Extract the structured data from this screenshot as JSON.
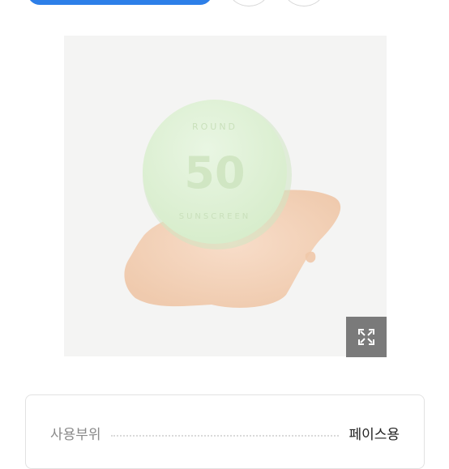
{
  "icons": {
    "expand": "expand-icon"
  },
  "colors": {
    "accent": "#2d7fe8",
    "image_background": "#f4f4f3",
    "cushion_green": "#dff0d7",
    "foundation": "#f1cfb4"
  },
  "info": {
    "label": "사용부위",
    "value": "페이스용"
  }
}
